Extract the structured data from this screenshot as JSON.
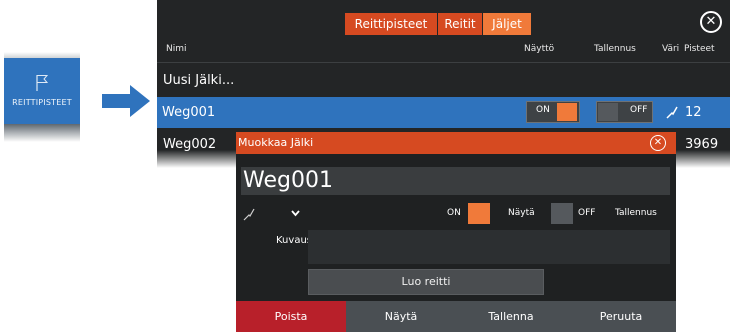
{
  "side_button": {
    "label": "REITTIPISTEET",
    "icon": "flag-icon"
  },
  "arrow": {
    "icon": "arrow-right-icon",
    "color": "#2f73bd"
  },
  "main_panel": {
    "tabs": [
      {
        "label": "Reittipisteet",
        "active": false
      },
      {
        "label": "Reitit",
        "active": false
      },
      {
        "label": "Jäljet",
        "active": true
      }
    ],
    "close_icon": "close-icon",
    "columns": {
      "name": "Nimi",
      "display": "Näyttö",
      "record": "Tallennus",
      "color": "Väri",
      "points": "Pisteet"
    },
    "new_track": "Uusi Jälki...",
    "rows": [
      {
        "name": "Weg001",
        "display": "ON",
        "record": "OFF",
        "color_icon": "line-style-icon",
        "points": "12",
        "selected": true
      },
      {
        "name": "Weg002",
        "points": "3969",
        "selected": false
      }
    ]
  },
  "dialog": {
    "title": "Muokkaa Jälki",
    "name_value": "Weg001",
    "style_icon": "line-style-icon",
    "display_on_label": "ON",
    "display_label": "Näytä",
    "record_off_label": "OFF",
    "record_label": "Tallennus",
    "description_label": "Kuvaus",
    "description_value": "",
    "create_route_label": "Luo reitti",
    "buttons": [
      "Poista",
      "Näytä",
      "Tallenna",
      "Peruuta"
    ]
  },
  "colors": {
    "accent_orange": "#d64a21",
    "active_tab": "#f07a3a",
    "selection_blue": "#2f73bd",
    "delete_red": "#b8202a",
    "button_gray": "#4a4f53"
  }
}
